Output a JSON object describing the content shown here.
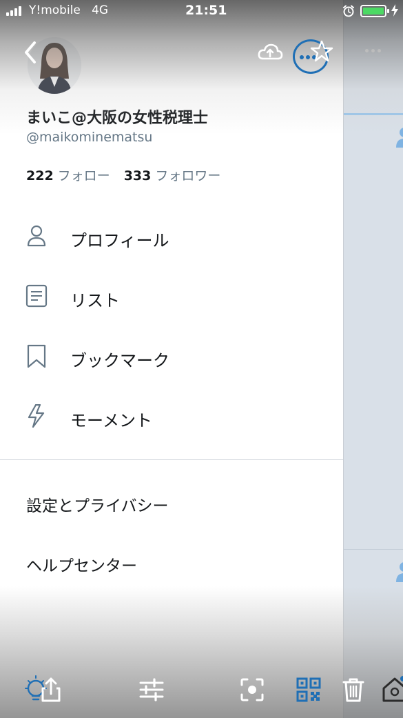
{
  "status_bar": {
    "carrier": "Y!mobile",
    "network": "4G",
    "time": "21:51"
  },
  "drawer": {
    "profile": {
      "name": "まいこ@大阪の女性税理士",
      "handle": "@maikominematsu",
      "following_count": "222",
      "following_label": "フォロー",
      "followers_count": "333",
      "followers_label": "フォロワー"
    },
    "menu": [
      {
        "label": "プロフィール",
        "icon": "person-icon"
      },
      {
        "label": "リスト",
        "icon": "list-icon"
      },
      {
        "label": "ブックマーク",
        "icon": "bookmark-icon"
      },
      {
        "label": "モーメント",
        "icon": "lightning-icon"
      }
    ],
    "secondary": [
      {
        "label": "設定とプライバシー"
      },
      {
        "label": "ヘルプセンター"
      }
    ]
  },
  "toolbar": {
    "icons": [
      "lightbulb-icon",
      "share-icon",
      "sliders-icon",
      "scan-icon",
      "qr-code-icon",
      "trash-icon",
      "home-icon"
    ]
  },
  "colors": {
    "accent": "#1f6fb5",
    "text_primary": "#14171a",
    "text_secondary": "#657786",
    "battery": "#4cd964"
  }
}
